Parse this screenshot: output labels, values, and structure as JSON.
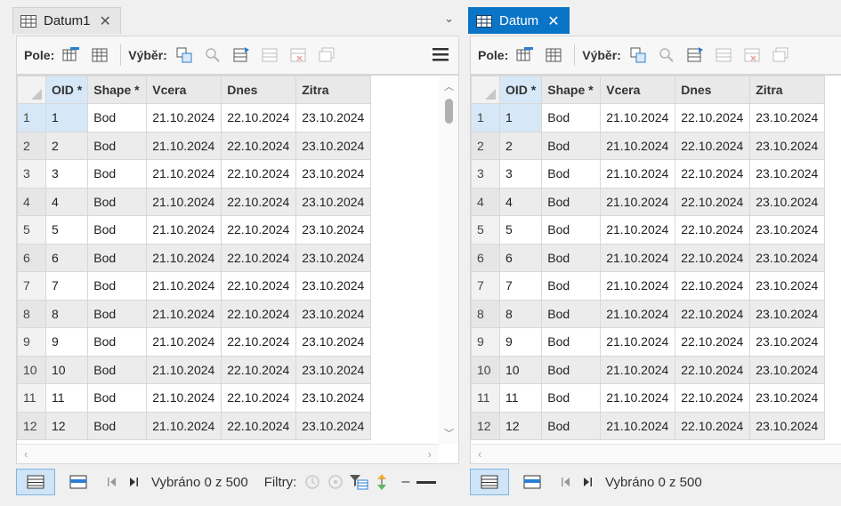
{
  "colors": {
    "accent": "#0a74c7",
    "selection": "#d6e8f7"
  },
  "left": {
    "tab": {
      "label": "Datum1",
      "close": "✕",
      "icon": "table-icon"
    },
    "overflow": "⌄",
    "toolbar": {
      "fields_label": "Pole:",
      "selection_label": "Výběr:",
      "menu": "≡"
    },
    "status": {
      "text": "Vybráno 0 z 500",
      "filters_label": "Filtry:"
    }
  },
  "right": {
    "tab": {
      "label": "Datum",
      "close": "✕",
      "icon": "table-icon"
    },
    "toolbar": {
      "fields_label": "Pole:",
      "selection_label": "Výběr:"
    },
    "status": {
      "text": "Vybráno 0 z 500"
    }
  },
  "table": {
    "columns": [
      "OID *",
      "Shape *",
      "Vcera",
      "Dnes",
      "Zitra"
    ],
    "rows": [
      {
        "n": "1",
        "oid": "1",
        "shape": "Bod",
        "vcera": "21.10.2024",
        "dnes": "22.10.2024",
        "zitra": "23.10.2024"
      },
      {
        "n": "2",
        "oid": "2",
        "shape": "Bod",
        "vcera": "21.10.2024",
        "dnes": "22.10.2024",
        "zitra": "23.10.2024"
      },
      {
        "n": "3",
        "oid": "3",
        "shape": "Bod",
        "vcera": "21.10.2024",
        "dnes": "22.10.2024",
        "zitra": "23.10.2024"
      },
      {
        "n": "4",
        "oid": "4",
        "shape": "Bod",
        "vcera": "21.10.2024",
        "dnes": "22.10.2024",
        "zitra": "23.10.2024"
      },
      {
        "n": "5",
        "oid": "5",
        "shape": "Bod",
        "vcera": "21.10.2024",
        "dnes": "22.10.2024",
        "zitra": "23.10.2024"
      },
      {
        "n": "6",
        "oid": "6",
        "shape": "Bod",
        "vcera": "21.10.2024",
        "dnes": "22.10.2024",
        "zitra": "23.10.2024"
      },
      {
        "n": "7",
        "oid": "7",
        "shape": "Bod",
        "vcera": "21.10.2024",
        "dnes": "22.10.2024",
        "zitra": "23.10.2024"
      },
      {
        "n": "8",
        "oid": "8",
        "shape": "Bod",
        "vcera": "21.10.2024",
        "dnes": "22.10.2024",
        "zitra": "23.10.2024"
      },
      {
        "n": "9",
        "oid": "9",
        "shape": "Bod",
        "vcera": "21.10.2024",
        "dnes": "22.10.2024",
        "zitra": "23.10.2024"
      },
      {
        "n": "10",
        "oid": "10",
        "shape": "Bod",
        "vcera": "21.10.2024",
        "dnes": "22.10.2024",
        "zitra": "23.10.2024"
      },
      {
        "n": "11",
        "oid": "11",
        "shape": "Bod",
        "vcera": "21.10.2024",
        "dnes": "22.10.2024",
        "zitra": "23.10.2024"
      },
      {
        "n": "12",
        "oid": "12",
        "shape": "Bod",
        "vcera": "21.10.2024",
        "dnes": "22.10.2024",
        "zitra": "23.10.2024"
      }
    ]
  }
}
